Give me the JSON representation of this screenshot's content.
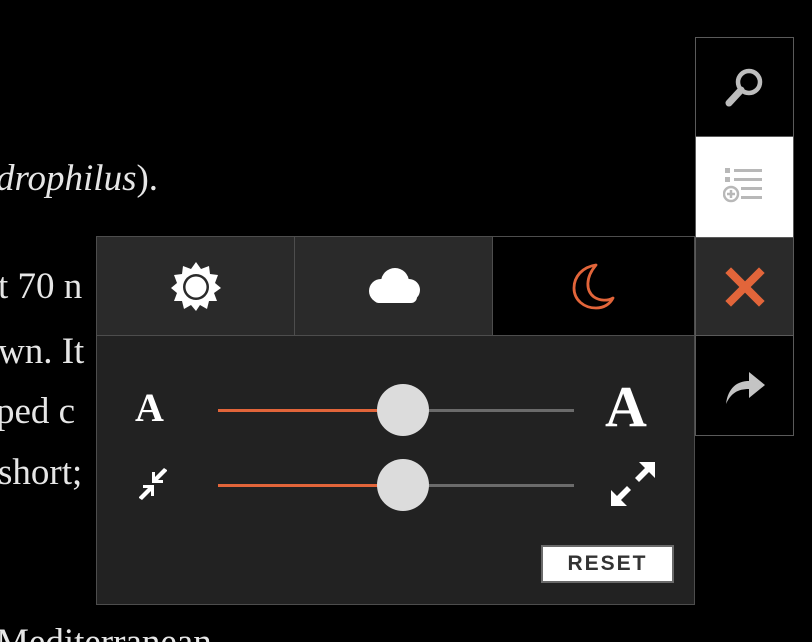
{
  "article": {
    "lines": [
      {
        "prefix": "",
        "italic": "drophilus",
        "suffix": ")."
      },
      {
        "prefix": "t 70 n",
        "italic": "",
        "suffix": ""
      },
      {
        "prefix": "wn. It",
        "italic": "",
        "suffix": ""
      },
      {
        "prefix": "ped c",
        "italic": "",
        "suffix": ""
      },
      {
        "prefix": "short;",
        "italic": "",
        "suffix": ""
      },
      {
        "prefix": "Mediterranean",
        "italic": "",
        "suffix": ""
      }
    ]
  },
  "toolbar": {
    "search_icon": "search-icon",
    "toc_icon": "table-of-contents-icon",
    "close_icon": "close-icon",
    "share_icon": "share-icon",
    "toc_active": true
  },
  "settings": {
    "themes": [
      {
        "id": "day",
        "icon": "sun-icon",
        "selected": false
      },
      {
        "id": "dusk",
        "icon": "cloud-icon",
        "selected": false
      },
      {
        "id": "night",
        "icon": "moon-icon",
        "selected": true
      }
    ],
    "font_size": {
      "small_label": "A",
      "large_label": "A",
      "value": 0.52
    },
    "page_width": {
      "small_icon": "shrink-icon",
      "large_icon": "expand-icon",
      "value": 0.52
    },
    "reset_label": "RESET"
  },
  "colors": {
    "accent": "#e2653a",
    "panel_bg": "#222222",
    "thumb": "#dcdcdc"
  }
}
